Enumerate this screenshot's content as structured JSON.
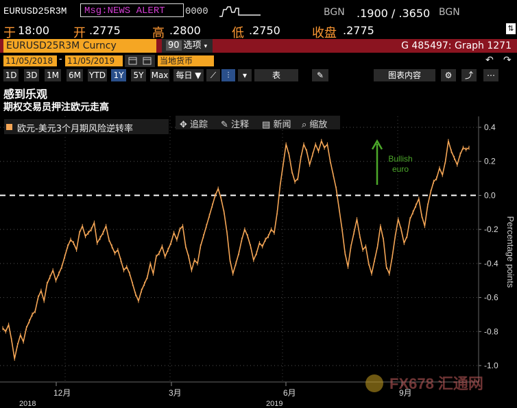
{
  "header": {
    "ticker": "EURUSD25R3M",
    "alert": "Msg:NEWS ALERT",
    "alert_extra": "0000",
    "bgn_left": "BGN",
    "bid_ask": ".1900 / .3650",
    "bgn_right": "BGN"
  },
  "quote": {
    "prev_label": "于",
    "prev_value": "18:00",
    "open_label": "开",
    "open_value": ".2775",
    "high_label": "高",
    "high_value": ".2800",
    "low_label": "低",
    "low_value": ".2750",
    "close_label": "收盘",
    "close_value": ".2775"
  },
  "security": {
    "field": "EURUSD25R3M Curncy",
    "options_num": "90",
    "options_label": "选项",
    "graph_id": "G 485497: Graph 1271"
  },
  "dates": {
    "start": "11/05/2018",
    "end": "11/05/2019",
    "currency": "当地货币"
  },
  "toolbar": {
    "periods": [
      "1D",
      "3D",
      "1M",
      "6M",
      "YTD",
      "1Y",
      "5Y",
      "Max"
    ],
    "selected_period": "1Y",
    "daily": "每日 ▼",
    "table": "表",
    "chart_content": "图表内容"
  },
  "titles": {
    "headline": "感到乐观",
    "subhead": "期权交易员押注欧元走高"
  },
  "legend": {
    "series": "欧元-美元3个月期风险逆转率"
  },
  "tools": {
    "track": "追踪",
    "annotate": "注释",
    "news": "新闻",
    "zoom": "缩放"
  },
  "annotation": {
    "text_line1": "Bullish",
    "text_line2": "euro",
    "color": "#4ca82a"
  },
  "watermark": {
    "text": "FX678 汇通网"
  },
  "colors": {
    "series": "#f5a656",
    "accent": "#f5a623",
    "bar": "#8b1420"
  },
  "chart_data": {
    "type": "line",
    "ylabel": "Percentage points",
    "ylim": [
      -1.0,
      0.4
    ],
    "yticks": [
      "0.4",
      "0.2",
      "0.0",
      "-0.2",
      "-0.4",
      "-0.6",
      "-0.8",
      "-1.0"
    ],
    "xticks": [
      "12月",
      "3月",
      "6月",
      "9月"
    ],
    "xyears": [
      "2018",
      "2019"
    ],
    "reference_line": 0.0,
    "series": [
      {
        "values": [
          -0.78,
          -0.8,
          -0.76,
          -0.85,
          -0.96,
          -0.88,
          -0.82,
          -0.86,
          -0.78,
          -0.74,
          -0.7,
          -0.68,
          -0.6,
          -0.56,
          -0.62,
          -0.52,
          -0.48,
          -0.44,
          -0.5,
          -0.46,
          -0.42,
          -0.36,
          -0.3,
          -0.26,
          -0.28,
          -0.32,
          -0.22,
          -0.18,
          -0.24,
          -0.22,
          -0.2,
          -0.16,
          -0.28,
          -0.25,
          -0.22,
          -0.18,
          -0.26,
          -0.3,
          -0.34,
          -0.32,
          -0.38,
          -0.44,
          -0.42,
          -0.46,
          -0.52,
          -0.58,
          -0.62,
          -0.56,
          -0.52,
          -0.48,
          -0.4,
          -0.46,
          -0.36,
          -0.34,
          -0.3,
          -0.36,
          -0.32,
          -0.28,
          -0.22,
          -0.26,
          -0.2,
          -0.18,
          -0.3,
          -0.36,
          -0.44,
          -0.38,
          -0.4,
          -0.3,
          -0.24,
          -0.18,
          -0.12,
          -0.06,
          0.0,
          0.04,
          -0.02,
          -0.1,
          -0.22,
          -0.38,
          -0.46,
          -0.4,
          -0.34,
          -0.26,
          -0.2,
          -0.24,
          -0.3,
          -0.38,
          -0.34,
          -0.28,
          -0.3,
          -0.26,
          -0.24,
          -0.2,
          -0.22,
          -0.1,
          0.06,
          0.18,
          0.3,
          0.24,
          0.14,
          0.08,
          0.1,
          0.22,
          0.3,
          0.26,
          0.18,
          0.24,
          0.3,
          0.26,
          0.32,
          0.28,
          0.3,
          0.2,
          0.12,
          0.04,
          -0.08,
          -0.2,
          -0.34,
          -0.42,
          -0.3,
          -0.22,
          -0.14,
          -0.24,
          -0.32,
          -0.3,
          -0.4,
          -0.46,
          -0.38,
          -0.3,
          -0.18,
          -0.26,
          -0.42,
          -0.46,
          -0.36,
          -0.24,
          -0.14,
          -0.2,
          -0.28,
          -0.24,
          -0.14,
          -0.1,
          -0.06,
          -0.02,
          -0.12,
          -0.18,
          -0.06,
          0.02,
          0.08,
          0.1,
          0.16,
          0.12,
          0.2,
          0.32,
          0.26,
          0.22,
          0.18,
          0.24,
          0.28,
          0.27,
          0.28
        ]
      }
    ]
  }
}
